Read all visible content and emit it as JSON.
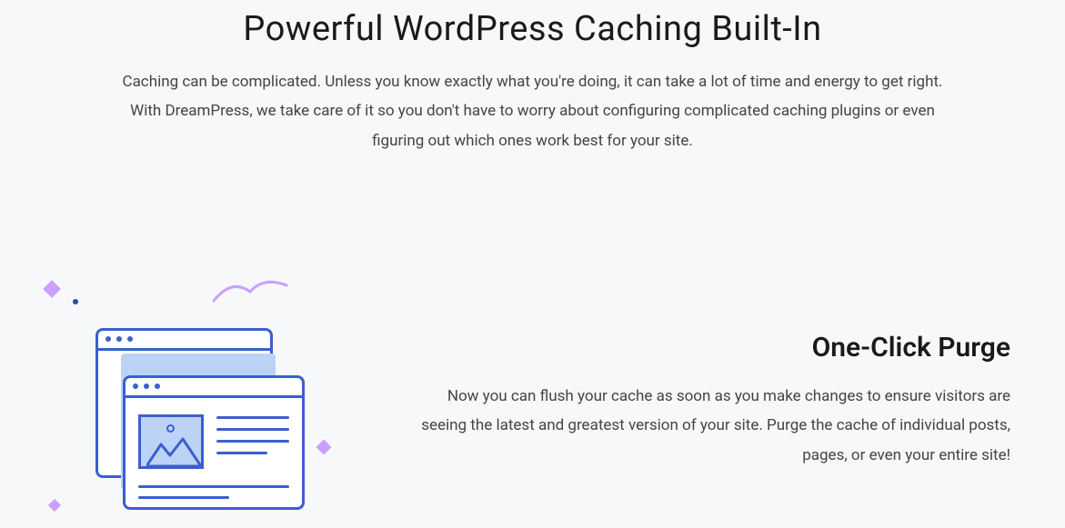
{
  "hero": {
    "title": "Powerful WordPress Caching Built-In",
    "description": "Caching can be complicated. Unless you know exactly what you're doing, it can take a lot of time and energy to get right. With DreamPress, we take care of it so you don't have to worry about configuring complicated caching plugins or even figuring out which ones work best for your site."
  },
  "feature": {
    "title": "One-Click Purge",
    "description": "Now you can flush your cache as soon as you make changes to ensure visitors are seeing the latest and greatest version of your site. Purge the cache of individual posts, pages, or even your entire site!"
  },
  "colors": {
    "accent_blue": "#3a5fd0",
    "light_blue": "#bdd3f5",
    "sparkle": "#c9a0ff",
    "background": "#f7f8fa"
  }
}
